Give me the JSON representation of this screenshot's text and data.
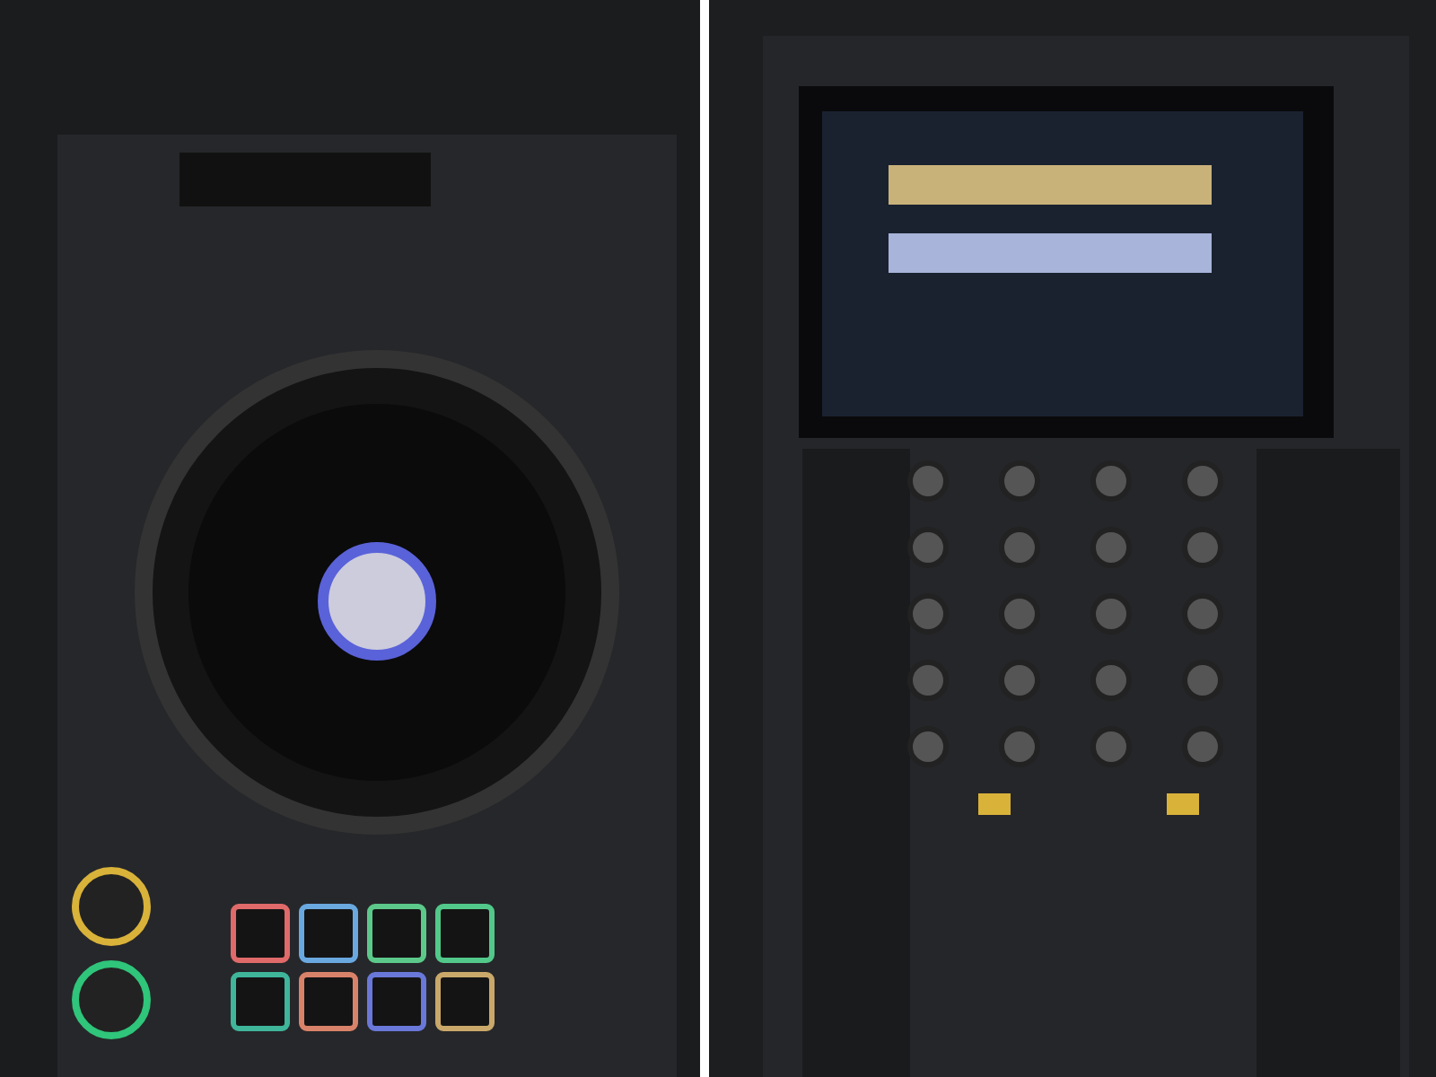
{
  "left_unit": {
    "pads": [
      {
        "color": "#e06a6a"
      },
      {
        "color": "#6aa8e0"
      },
      {
        "color": "#5cc98a"
      },
      {
        "color": "#52c98a"
      },
      {
        "color": "#3fb59a"
      },
      {
        "color": "#d9826a"
      },
      {
        "color": "#6a78d9"
      },
      {
        "color": "#c9a86a"
      }
    ]
  }
}
